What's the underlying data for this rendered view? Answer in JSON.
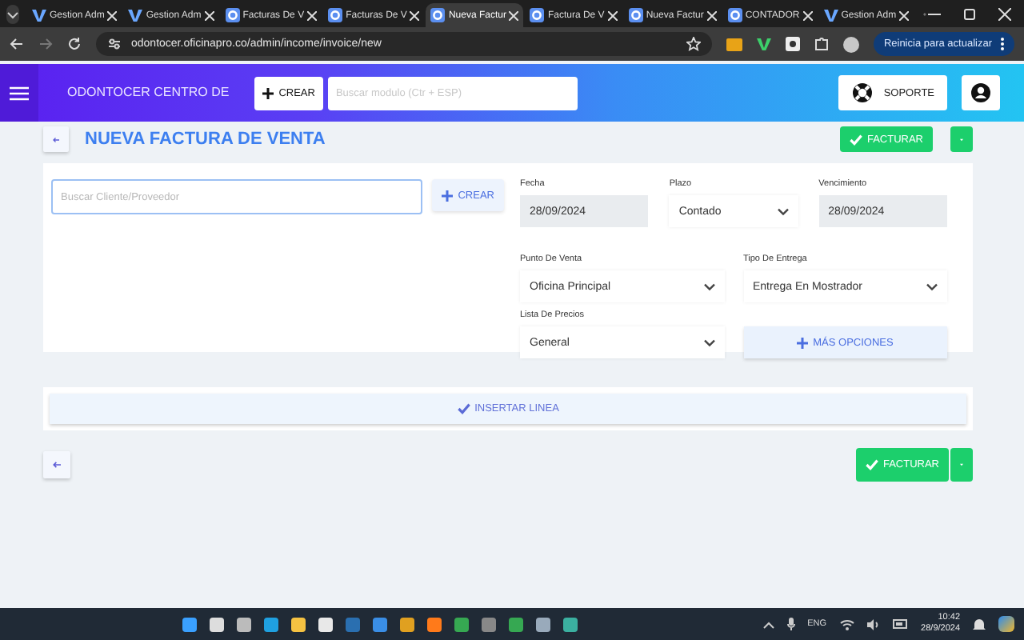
{
  "browser": {
    "tabs": [
      {
        "title": "Gestion Adm",
        "kind": "v",
        "selected": false
      },
      {
        "title": "Gestion Adm",
        "kind": "v",
        "selected": false
      },
      {
        "title": "Facturas De V",
        "kind": "o",
        "selected": false
      },
      {
        "title": "Facturas De V",
        "kind": "o",
        "selected": false
      },
      {
        "title": "Nueva Factur",
        "kind": "o",
        "selected": true
      },
      {
        "title": "Factura De V",
        "kind": "o",
        "selected": false
      },
      {
        "title": "Nueva Factur",
        "kind": "o",
        "selected": false
      },
      {
        "title": "CONTADOR",
        "kind": "o",
        "selected": false
      },
      {
        "title": "Gestion Adm",
        "kind": "v",
        "selected": false
      }
    ],
    "url": "odontocer.oficinapro.co/admin/income/invoice/new",
    "update_button": "Reinicia para actualizar"
  },
  "header": {
    "brand": "ODONTOCER CENTRO DE",
    "create_button": "CREAR",
    "search": {
      "placeholder": "Buscar modulo (Ctr + ESP)"
    },
    "support_button": "SOPORTE"
  },
  "page": {
    "title": "NUEVA FACTURA DE VENTA",
    "top_submit": "FACTURAR",
    "client": {
      "placeholder": "Buscar Cliente/Proveedor",
      "create_button": "CREAR"
    },
    "fields": [
      {
        "label": "Fecha",
        "value": "28/09/2024",
        "kind": "date",
        "disabled": true
      },
      {
        "label": "Plazo",
        "value": "Contado",
        "kind": "select",
        "disabled": false
      },
      {
        "label": "Vencimiento",
        "value": "28/09/2024",
        "kind": "date",
        "disabled": true
      },
      {
        "label": "Punto De Venta",
        "value": "Oficina Principal",
        "kind": "select",
        "disabled": false
      },
      {
        "label": "Tipo De Entrega",
        "value": "Entrega En Mostrador",
        "kind": "select",
        "disabled": false
      },
      {
        "label": "Lista De Precios",
        "value": "General",
        "kind": "select",
        "disabled": false
      },
      {
        "label": "MÁS OPCIONES",
        "kind": "button"
      }
    ],
    "insert_line": "INSERTAR LINEA",
    "submit": "FACTURAR"
  },
  "taskbar": {
    "language": "ENG",
    "time": "10:42",
    "date": "28/9/2024"
  }
}
